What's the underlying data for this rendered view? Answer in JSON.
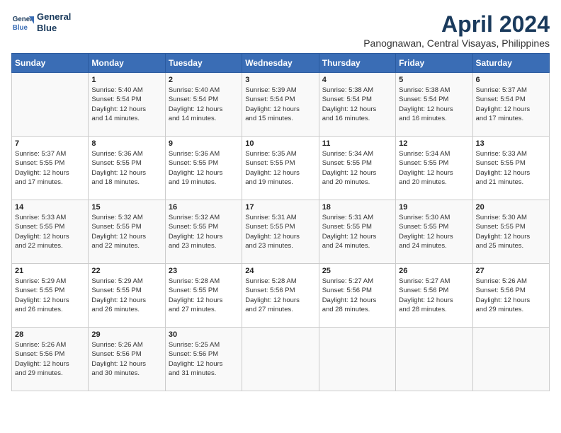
{
  "header": {
    "logo_line1": "General",
    "logo_line2": "Blue",
    "month_title": "April 2024",
    "subtitle": "Panognawan, Central Visayas, Philippines"
  },
  "columns": [
    "Sunday",
    "Monday",
    "Tuesday",
    "Wednesday",
    "Thursday",
    "Friday",
    "Saturday"
  ],
  "weeks": [
    [
      {
        "day": "",
        "info": ""
      },
      {
        "day": "1",
        "info": "Sunrise: 5:40 AM\nSunset: 5:54 PM\nDaylight: 12 hours\nand 14 minutes."
      },
      {
        "day": "2",
        "info": "Sunrise: 5:40 AM\nSunset: 5:54 PM\nDaylight: 12 hours\nand 14 minutes."
      },
      {
        "day": "3",
        "info": "Sunrise: 5:39 AM\nSunset: 5:54 PM\nDaylight: 12 hours\nand 15 minutes."
      },
      {
        "day": "4",
        "info": "Sunrise: 5:38 AM\nSunset: 5:54 PM\nDaylight: 12 hours\nand 16 minutes."
      },
      {
        "day": "5",
        "info": "Sunrise: 5:38 AM\nSunset: 5:54 PM\nDaylight: 12 hours\nand 16 minutes."
      },
      {
        "day": "6",
        "info": "Sunrise: 5:37 AM\nSunset: 5:54 PM\nDaylight: 12 hours\nand 17 minutes."
      }
    ],
    [
      {
        "day": "7",
        "info": "Sunrise: 5:37 AM\nSunset: 5:55 PM\nDaylight: 12 hours\nand 17 minutes."
      },
      {
        "day": "8",
        "info": "Sunrise: 5:36 AM\nSunset: 5:55 PM\nDaylight: 12 hours\nand 18 minutes."
      },
      {
        "day": "9",
        "info": "Sunrise: 5:36 AM\nSunset: 5:55 PM\nDaylight: 12 hours\nand 19 minutes."
      },
      {
        "day": "10",
        "info": "Sunrise: 5:35 AM\nSunset: 5:55 PM\nDaylight: 12 hours\nand 19 minutes."
      },
      {
        "day": "11",
        "info": "Sunrise: 5:34 AM\nSunset: 5:55 PM\nDaylight: 12 hours\nand 20 minutes."
      },
      {
        "day": "12",
        "info": "Sunrise: 5:34 AM\nSunset: 5:55 PM\nDaylight: 12 hours\nand 20 minutes."
      },
      {
        "day": "13",
        "info": "Sunrise: 5:33 AM\nSunset: 5:55 PM\nDaylight: 12 hours\nand 21 minutes."
      }
    ],
    [
      {
        "day": "14",
        "info": "Sunrise: 5:33 AM\nSunset: 5:55 PM\nDaylight: 12 hours\nand 22 minutes."
      },
      {
        "day": "15",
        "info": "Sunrise: 5:32 AM\nSunset: 5:55 PM\nDaylight: 12 hours\nand 22 minutes."
      },
      {
        "day": "16",
        "info": "Sunrise: 5:32 AM\nSunset: 5:55 PM\nDaylight: 12 hours\nand 23 minutes."
      },
      {
        "day": "17",
        "info": "Sunrise: 5:31 AM\nSunset: 5:55 PM\nDaylight: 12 hours\nand 23 minutes."
      },
      {
        "day": "18",
        "info": "Sunrise: 5:31 AM\nSunset: 5:55 PM\nDaylight: 12 hours\nand 24 minutes."
      },
      {
        "day": "19",
        "info": "Sunrise: 5:30 AM\nSunset: 5:55 PM\nDaylight: 12 hours\nand 24 minutes."
      },
      {
        "day": "20",
        "info": "Sunrise: 5:30 AM\nSunset: 5:55 PM\nDaylight: 12 hours\nand 25 minutes."
      }
    ],
    [
      {
        "day": "21",
        "info": "Sunrise: 5:29 AM\nSunset: 5:55 PM\nDaylight: 12 hours\nand 26 minutes."
      },
      {
        "day": "22",
        "info": "Sunrise: 5:29 AM\nSunset: 5:55 PM\nDaylight: 12 hours\nand 26 minutes."
      },
      {
        "day": "23",
        "info": "Sunrise: 5:28 AM\nSunset: 5:55 PM\nDaylight: 12 hours\nand 27 minutes."
      },
      {
        "day": "24",
        "info": "Sunrise: 5:28 AM\nSunset: 5:56 PM\nDaylight: 12 hours\nand 27 minutes."
      },
      {
        "day": "25",
        "info": "Sunrise: 5:27 AM\nSunset: 5:56 PM\nDaylight: 12 hours\nand 28 minutes."
      },
      {
        "day": "26",
        "info": "Sunrise: 5:27 AM\nSunset: 5:56 PM\nDaylight: 12 hours\nand 28 minutes."
      },
      {
        "day": "27",
        "info": "Sunrise: 5:26 AM\nSunset: 5:56 PM\nDaylight: 12 hours\nand 29 minutes."
      }
    ],
    [
      {
        "day": "28",
        "info": "Sunrise: 5:26 AM\nSunset: 5:56 PM\nDaylight: 12 hours\nand 29 minutes."
      },
      {
        "day": "29",
        "info": "Sunrise: 5:26 AM\nSunset: 5:56 PM\nDaylight: 12 hours\nand 30 minutes."
      },
      {
        "day": "30",
        "info": "Sunrise: 5:25 AM\nSunset: 5:56 PM\nDaylight: 12 hours\nand 31 minutes."
      },
      {
        "day": "",
        "info": ""
      },
      {
        "day": "",
        "info": ""
      },
      {
        "day": "",
        "info": ""
      },
      {
        "day": "",
        "info": ""
      }
    ]
  ]
}
